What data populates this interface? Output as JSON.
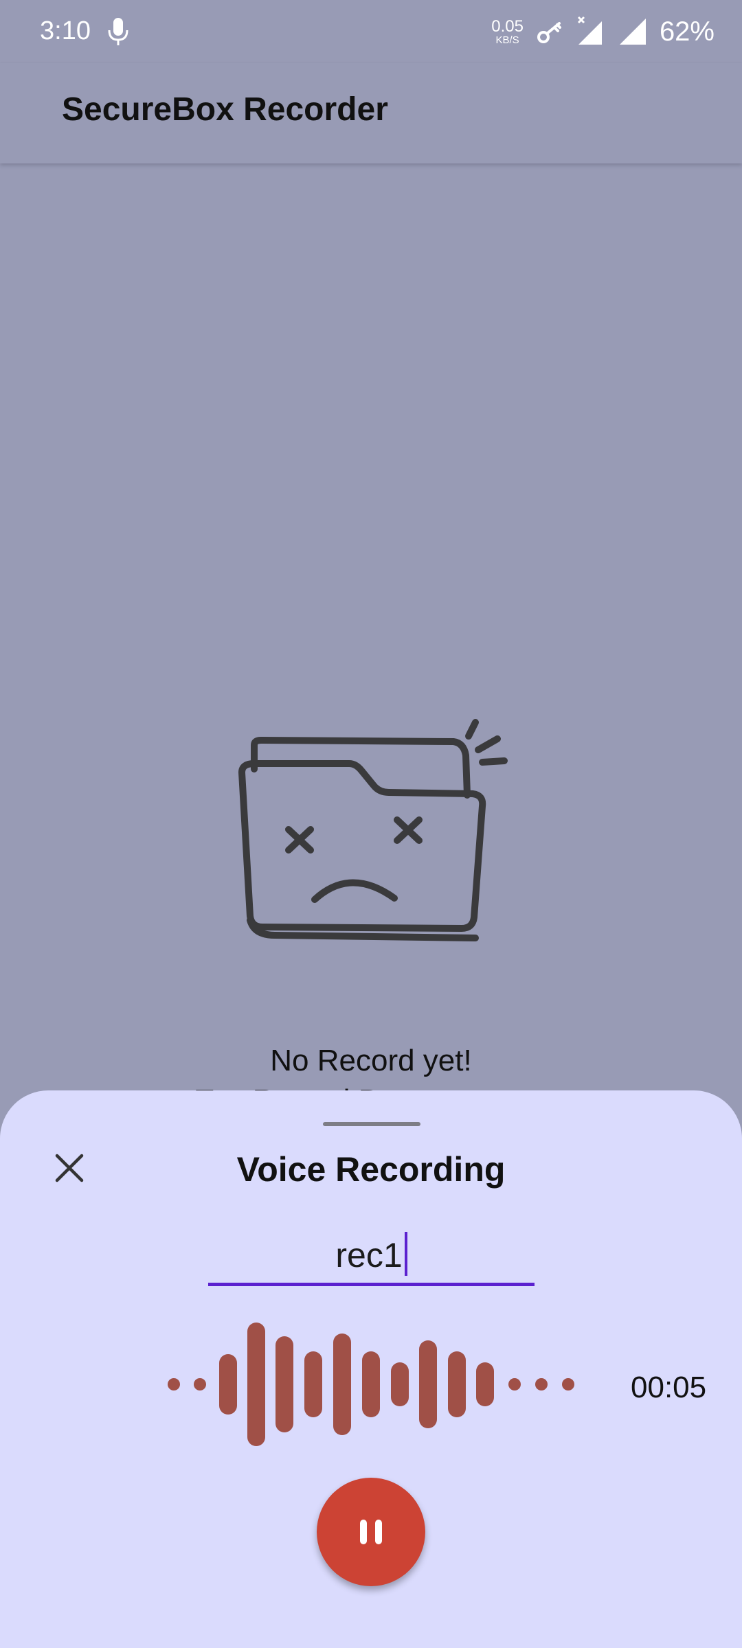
{
  "status_bar": {
    "time": "3:10",
    "net_speed_value": "0.05",
    "net_speed_unit": "KB/S",
    "battery": "62%",
    "icons": [
      "mic-icon",
      "vpn-key-icon",
      "signal-x-icon",
      "signal-icon"
    ]
  },
  "app_bar": {
    "title": "SecureBox Recorder"
  },
  "empty_state": {
    "title": "No Record yet!",
    "subtitle": "Tap Record Button to start",
    "illustration": "sad-folder-icon"
  },
  "recording_sheet": {
    "title": "Voice Recording",
    "close_icon": "close-icon",
    "name_value": "rec1",
    "timer": "00:05",
    "pause_icon": "pause-icon",
    "colors": {
      "sheet_background": "#dadbfd",
      "accent": "#5b21cf",
      "wave": "#a05047",
      "pause_button": "#cc4334"
    }
  }
}
